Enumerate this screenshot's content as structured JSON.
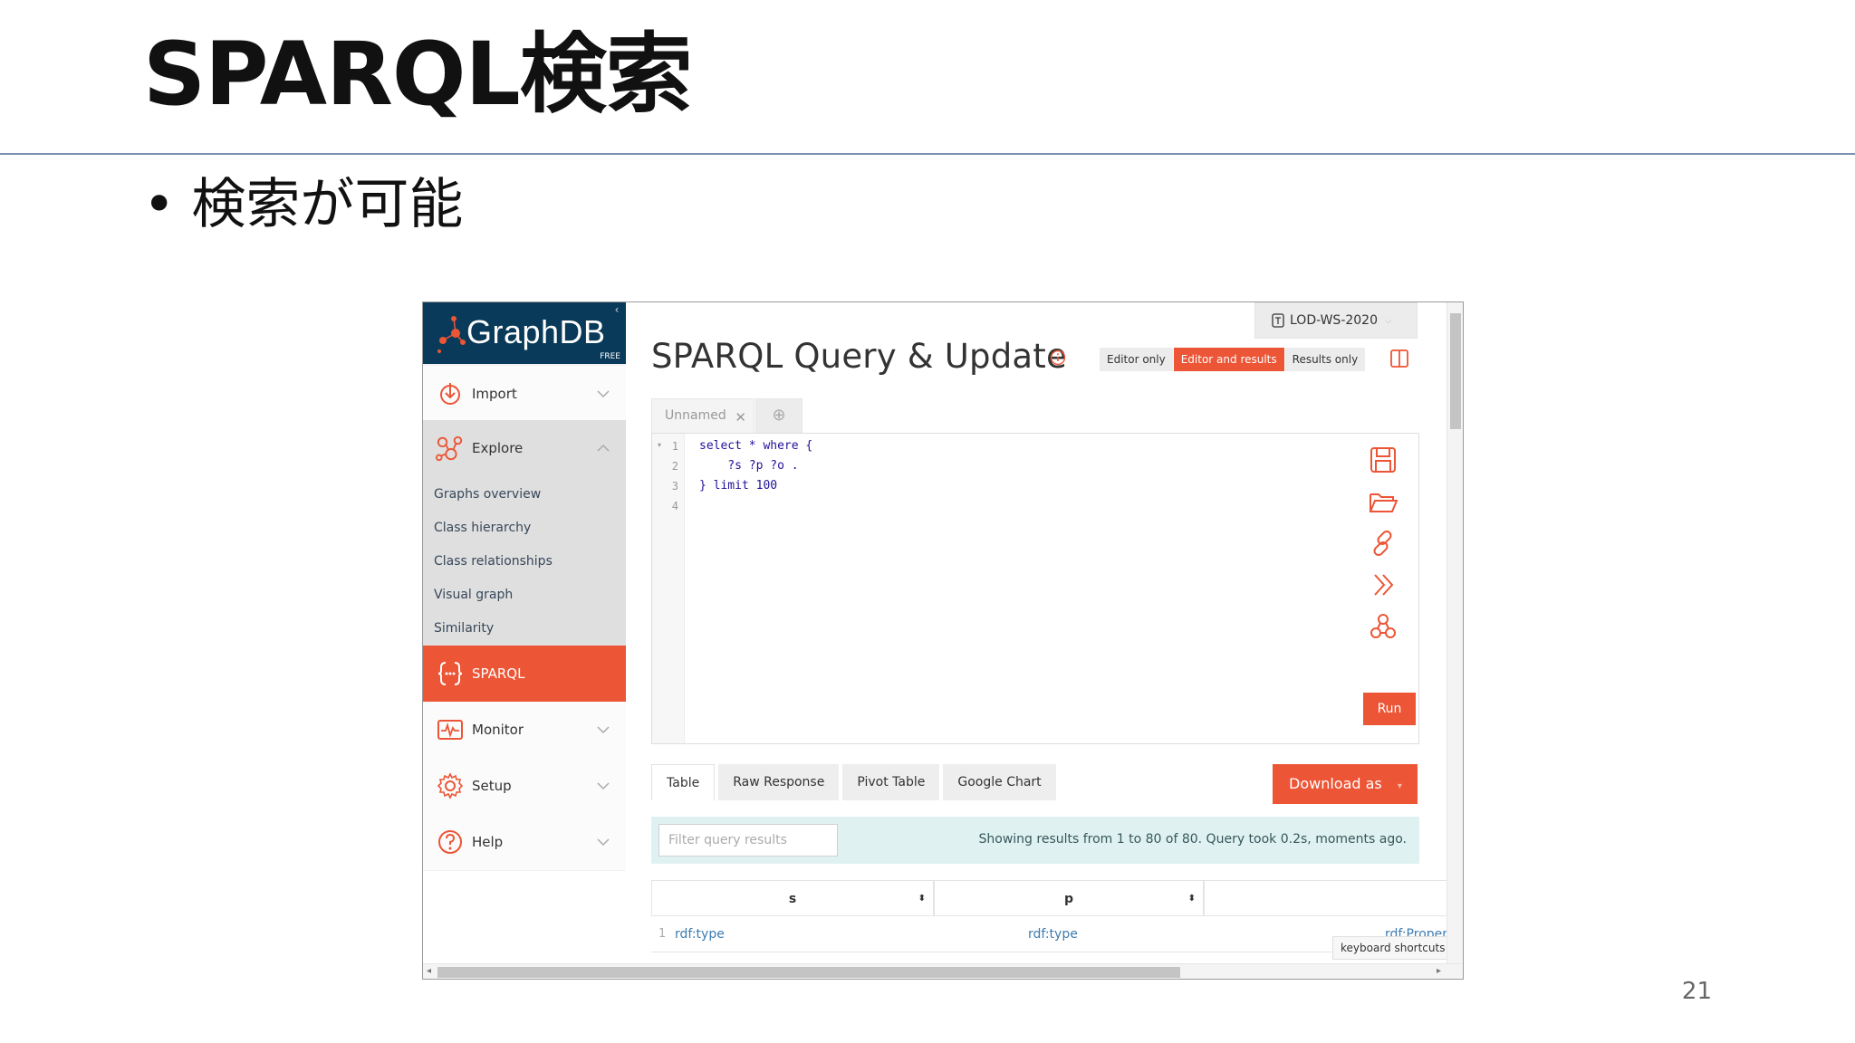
{
  "slide": {
    "title": "SPARQL検索",
    "bullet_dot": "•",
    "bullet_text": "検索が可能",
    "page_number": "21"
  },
  "graphdb": {
    "logo_text": "GraphDB",
    "logo_badge": "FREE",
    "collapse_glyph": "‹",
    "nav": {
      "import": "Import",
      "explore": "Explore",
      "explore_sub": [
        "Graphs overview",
        "Class hierarchy",
        "Class relationships",
        "Visual graph",
        "Similarity"
      ],
      "sparql": "SPARQL",
      "monitor": "Monitor",
      "setup": "Setup",
      "help": "Help"
    },
    "repository": "LOD-WS-2020",
    "page_title": "SPARQL Query & Update",
    "view_modes": [
      "Editor only",
      "Editor and results",
      "Results only"
    ],
    "active_view": "Editor and results",
    "query_tab": "Unnamed",
    "code_lines": [
      "select * where {",
      "    ?s ?p ?o .",
      "} limit 100",
      ""
    ],
    "line_numbers": [
      "1",
      "2",
      "3",
      "4"
    ],
    "run_label": "Run",
    "result_tabs": [
      "Table",
      "Raw Response",
      "Pivot Table",
      "Google Chart"
    ],
    "download_label": "Download as",
    "filter_placeholder": "Filter query results",
    "results_summary": "Showing results from 1 to 80 of 80. Query took 0.2s, moments ago.",
    "table": {
      "columns": [
        "s",
        "p"
      ],
      "rows": [
        {
          "index": "1",
          "s": "rdf:type",
          "p": "rdf:type",
          "o": "rdf:Property"
        }
      ]
    },
    "keyboard_shortcuts": "keyboard shortcuts",
    "accent_color": "#ec5535",
    "logo_bg_color": "#0a3a5a"
  }
}
